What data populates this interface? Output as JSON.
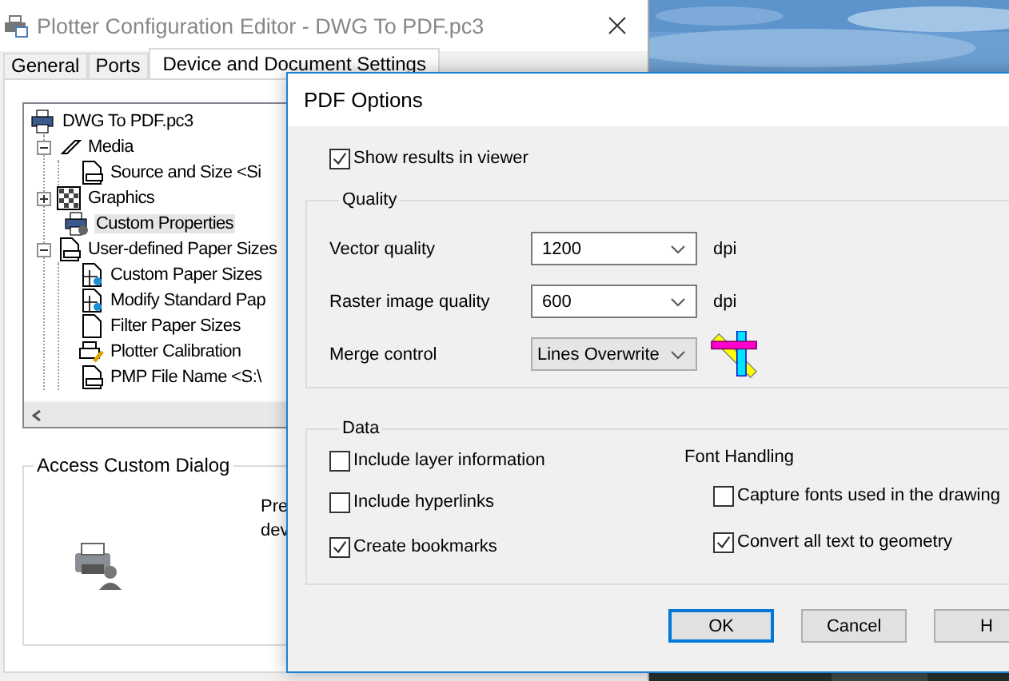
{
  "editor": {
    "title": "Plotter Configuration Editor - DWG To PDF.pc3",
    "tabs": [
      {
        "label": "General",
        "selected": false
      },
      {
        "label": "Ports",
        "selected": false
      },
      {
        "label": "Device and Document Settings",
        "selected": true
      }
    ],
    "tree": [
      {
        "label": "DWG To PDF.pc3",
        "kind": "printer",
        "selected": false,
        "children": [
          {
            "label": "Media",
            "kind": "media",
            "selected": false,
            "expanded": true,
            "children": [
              {
                "label": "Source and Size <Si",
                "kind": "tray",
                "selected": false
              }
            ]
          },
          {
            "label": "Graphics",
            "kind": "graphics",
            "selected": false,
            "expanded": false
          },
          {
            "label": "Custom Properties",
            "kind": "custom",
            "selected": true
          },
          {
            "label": "User-defined Paper Sizes",
            "kind": "paper",
            "selected": false,
            "expanded": true,
            "children": [
              {
                "label": "Custom Paper Sizes",
                "kind": "paper-user",
                "selected": false
              },
              {
                "label": "Modify Standard Pap",
                "kind": "paper-user",
                "selected": false
              },
              {
                "label": "Filter Paper Sizes",
                "kind": "page",
                "selected": false
              },
              {
                "label": "Plotter Calibration",
                "kind": "calibration",
                "selected": false
              },
              {
                "label": "PMP File Name <S:\\",
                "kind": "paper",
                "selected": false
              }
            ]
          }
        ]
      }
    ],
    "access_group": {
      "title": "Access Custom Dialog",
      "text_lines": [
        "Pre",
        "dev"
      ]
    }
  },
  "dialog": {
    "title": "PDF Options",
    "show_results": {
      "label": "Show results in viewer",
      "checked": true
    },
    "quality": {
      "title": "Quality",
      "rows": [
        {
          "label": "Vector quality",
          "value": "1200",
          "unit": "dpi",
          "kind": "combo"
        },
        {
          "label": "Raster image quality",
          "value": "600",
          "unit": "dpi",
          "kind": "combo"
        },
        {
          "label": "Merge control",
          "value": "Lines Overwrite",
          "kind": "list"
        }
      ]
    },
    "data": {
      "title": "Data",
      "options": [
        {
          "label": "Include layer information",
          "checked": false
        },
        {
          "label": "Include hyperlinks",
          "checked": false
        },
        {
          "label": "Create bookmarks",
          "checked": true
        }
      ],
      "font_handling": {
        "title": "Font Handling",
        "options": [
          {
            "label": "Capture fonts used in the drawing",
            "checked": false
          },
          {
            "label": "Convert all text to geometry",
            "checked": true
          }
        ]
      }
    },
    "buttons": [
      {
        "label": "OK",
        "default": true
      },
      {
        "label": "Cancel",
        "default": false
      },
      {
        "label": "H",
        "default": false
      }
    ]
  }
}
